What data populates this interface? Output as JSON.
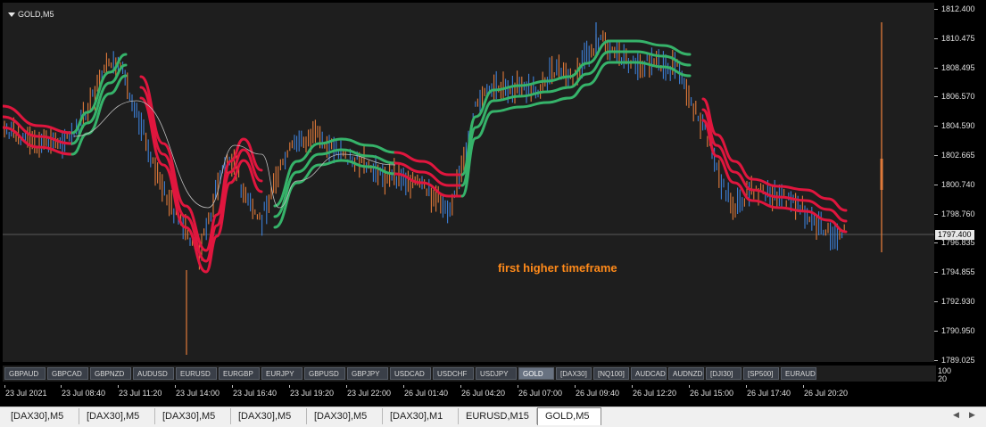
{
  "chart": {
    "title": "GOLD,M5",
    "annotation": "first higher timeframe",
    "current_price": "1797.400"
  },
  "price_axis": {
    "labels": [
      "1812.400",
      "1810.475",
      "1808.495",
      "1806.570",
      "1804.590",
      "1802.665",
      "1800.740",
      "1798.760",
      "1796.835",
      "1794.855",
      "1792.930",
      "1790.950",
      "1789.025"
    ]
  },
  "indicator_scale": {
    "top": "100",
    "bottom": "20"
  },
  "symbols": [
    {
      "label": "GBPAUD",
      "active": false
    },
    {
      "label": "GBPCAD",
      "active": false
    },
    {
      "label": "GBPNZD",
      "active": false
    },
    {
      "label": "AUDUSD",
      "active": false
    },
    {
      "label": "EURUSD",
      "active": false
    },
    {
      "label": "EURGBP",
      "active": false
    },
    {
      "label": "EURJPY",
      "active": false
    },
    {
      "label": "GBPUSD",
      "active": false
    },
    {
      "label": "GBPJPY",
      "active": false
    },
    {
      "label": "USDCAD",
      "active": false
    },
    {
      "label": "USDCHF",
      "active": false
    },
    {
      "label": "USDJPY",
      "active": false
    },
    {
      "label": "GOLD",
      "active": true
    },
    {
      "label": "[DAX30]",
      "active": false
    },
    {
      "label": "[NQ100]",
      "active": false
    },
    {
      "label": "AUDCAD",
      "active": false
    },
    {
      "label": "AUDNZD",
      "active": false
    },
    {
      "label": "[DJI30]",
      "active": false
    },
    {
      "label": "[SP500]",
      "active": false
    },
    {
      "label": "EURAUD",
      "active": false
    }
  ],
  "time_axis": {
    "labels": [
      "23 Jul 2021",
      "23 Jul 08:40",
      "23 Jul 11:20",
      "23 Jul 14:00",
      "23 Jul 16:40",
      "23 Jul 19:20",
      "23 Jul 22:00",
      "26 Jul 01:40",
      "26 Jul 04:20",
      "26 Jul 07:00",
      "26 Jul 09:40",
      "26 Jul 12:20",
      "26 Jul 15:00",
      "26 Jul 17:40",
      "26 Jul 20:20"
    ]
  },
  "tabs": [
    {
      "label": "[DAX30],M5",
      "active": false
    },
    {
      "label": "[DAX30],M5",
      "active": false
    },
    {
      "label": "[DAX30],M5",
      "active": false
    },
    {
      "label": "[DAX30],M5",
      "active": false
    },
    {
      "label": "[DAX30],M5",
      "active": false
    },
    {
      "label": "[DAX30],M1",
      "active": false
    },
    {
      "label": "EURUSD,M15",
      "active": false
    },
    {
      "label": "GOLD,M5",
      "active": true
    }
  ],
  "scroll": {
    "left": "◀",
    "right": "▶"
  },
  "colors": {
    "background": "#1e1e1e",
    "bull_bar": "#3d7fd6",
    "bear_bar": "#e07a3a",
    "ma_up": "#36b36a",
    "ma_down": "#e0163e",
    "annotation": "#ff8a1a"
  }
}
